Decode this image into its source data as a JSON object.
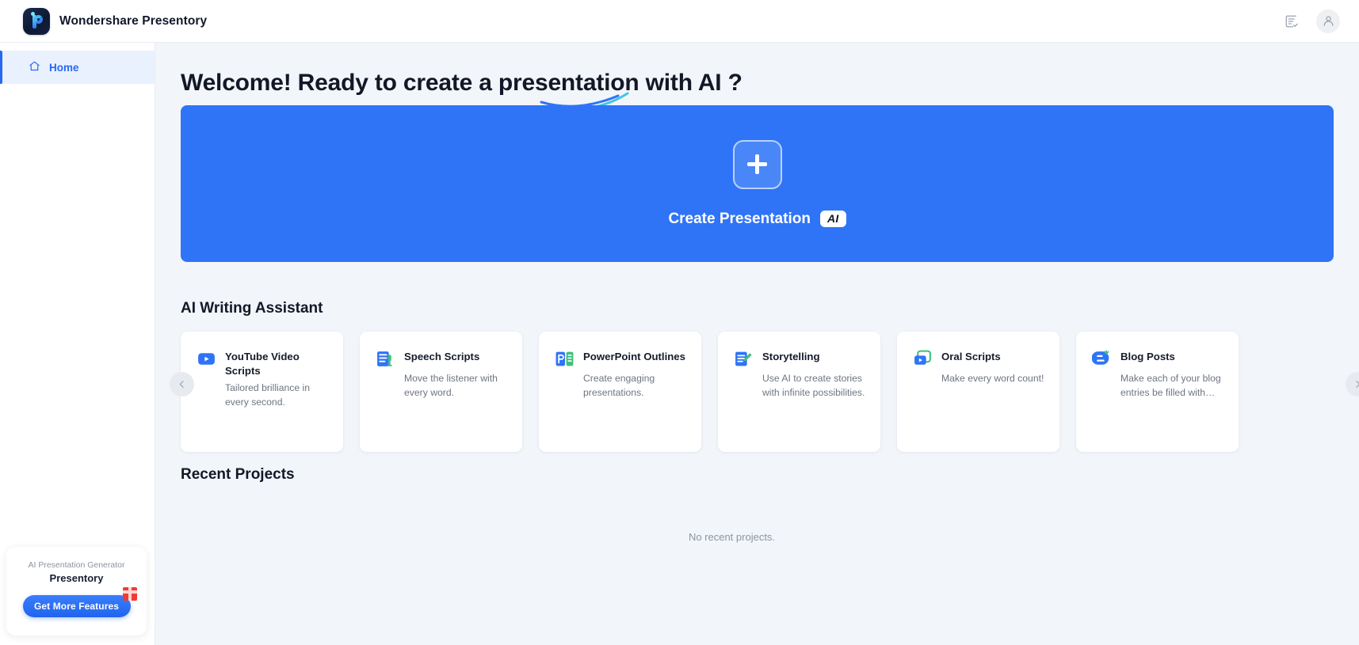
{
  "app": {
    "brand_name": "Wondershare Presentory",
    "logo_icon": "presentory-logo-icon"
  },
  "topbar": {
    "feedback_icon": "document-check-icon",
    "account_icon": "user-avatar-icon"
  },
  "sidebar": {
    "items": [
      {
        "label": "Home",
        "icon": "home-icon",
        "active": true
      }
    ],
    "promo": {
      "subtitle": "AI Presentation Generator",
      "title": "Presentory",
      "button_label": "Get More Features",
      "gift_icon": "gift-icon"
    }
  },
  "main": {
    "heading": "Welcome! Ready to create a presentation with AI ?",
    "hero": {
      "plus_icon": "plus-icon",
      "label": "Create Presentation",
      "badge": "AI",
      "background_color": "#2f74f7"
    },
    "assistant": {
      "title": "AI Writing Assistant",
      "prev_icon": "chevron-left-icon",
      "next_icon": "chevron-right-icon",
      "cards": [
        {
          "title": "YouTube Video Scripts",
          "desc": "Tailored brilliance in every second.",
          "icon": "youtube-play-icon"
        },
        {
          "title": "Speech Scripts",
          "desc": "Move the listener with every word.",
          "icon": "speech-microphone-icon"
        },
        {
          "title": "PowerPoint Outlines",
          "desc": "Create engaging presentations.",
          "icon": "powerpoint-outline-icon"
        },
        {
          "title": "Storytelling",
          "desc": "Use AI to create stories with infinite possibilities.",
          "icon": "story-pencil-icon"
        },
        {
          "title": "Oral Scripts",
          "desc": "Make every word count!",
          "icon": "oral-video-icon"
        },
        {
          "title": "Blog Posts",
          "desc": "Make each of your blog entries be filled with…",
          "icon": "blog-icon"
        }
      ]
    },
    "recent": {
      "title": "Recent Projects",
      "empty_text": "No recent projects."
    }
  }
}
